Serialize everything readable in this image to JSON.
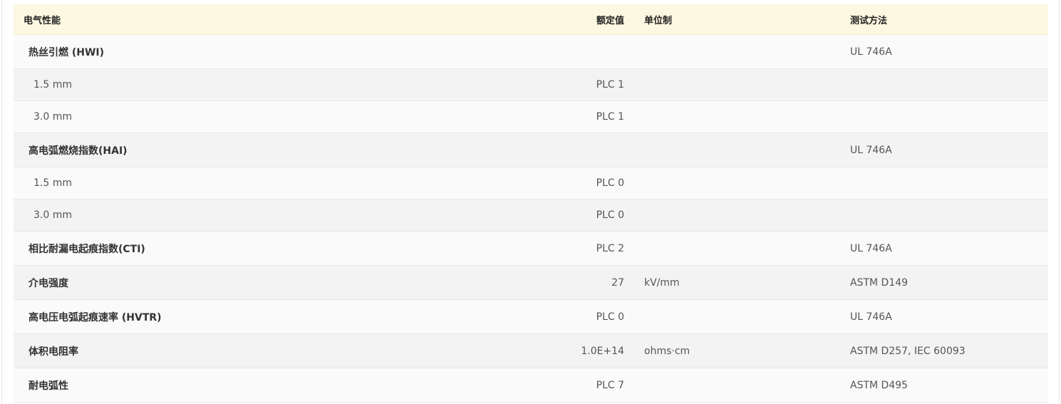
{
  "table": {
    "header": {
      "name": "电气性能",
      "value": "额定值",
      "unit": "单位制",
      "method": "测试方法"
    },
    "rows": [
      {
        "name": "热丝引燃 (HWI)",
        "value": "",
        "unit": "",
        "method": "UL 746A",
        "kind": "group"
      },
      {
        "name": "1.5 mm",
        "value": "PLC 1",
        "unit": "",
        "method": "",
        "kind": "sub"
      },
      {
        "name": "3.0 mm",
        "value": "PLC 1",
        "unit": "",
        "method": "",
        "kind": "sub"
      },
      {
        "name": "高电弧燃烧指数(HAI)",
        "value": "",
        "unit": "",
        "method": "UL 746A",
        "kind": "group"
      },
      {
        "name": "1.5 mm",
        "value": "PLC 0",
        "unit": "",
        "method": "",
        "kind": "sub"
      },
      {
        "name": "3.0 mm",
        "value": "PLC 0",
        "unit": "",
        "method": "",
        "kind": "sub"
      },
      {
        "name": "相比耐漏电起痕指数(CTI)",
        "value": "PLC 2",
        "unit": "",
        "method": "UL 746A",
        "kind": "group"
      },
      {
        "name": "介电强度",
        "value": "27",
        "unit": "kV/mm",
        "method": "ASTM D149",
        "kind": "group"
      },
      {
        "name": "高电压电弧起痕速率 (HVTR)",
        "value": "PLC 0",
        "unit": "",
        "method": "UL 746A",
        "kind": "group"
      },
      {
        "name": "体积电阻率",
        "value": "1.0E+14",
        "unit": "ohms·cm",
        "method": "ASTM D257, IEC 60093",
        "kind": "group"
      },
      {
        "name": "耐电弧性",
        "value": "PLC 7",
        "unit": "",
        "method": "ASTM D495",
        "kind": "group"
      }
    ]
  }
}
